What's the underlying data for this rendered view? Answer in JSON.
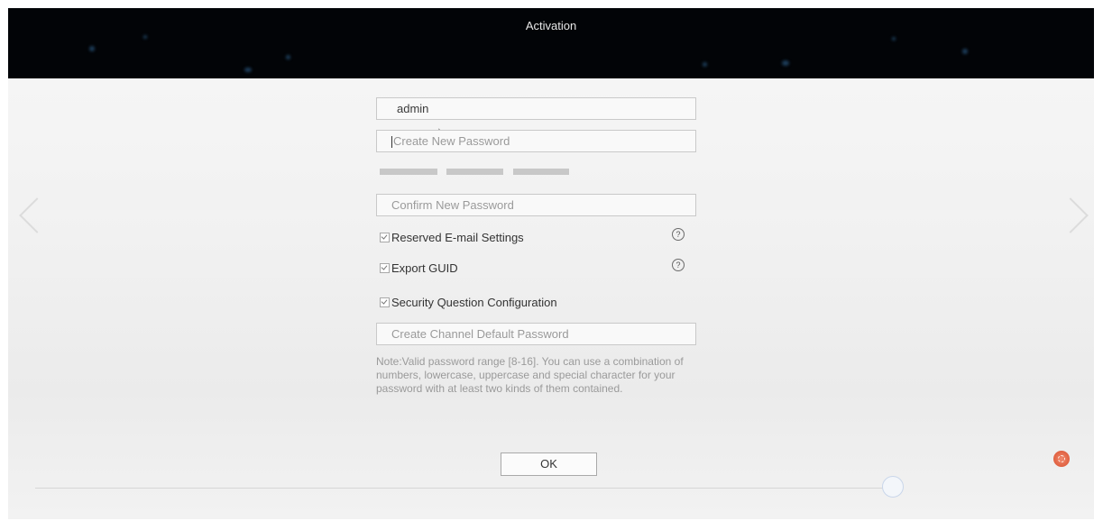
{
  "window": {
    "title": "Activation"
  },
  "form": {
    "username_value": "admin",
    "new_password_placeholder": "Create New Password",
    "confirm_password_placeholder": "Confirm New Password",
    "channel_password_placeholder": "Create Channel Default Password",
    "options": [
      {
        "label": "Reserved E-mail Settings",
        "checked": true,
        "help": true
      },
      {
        "label": "Export GUID",
        "checked": true,
        "help": true
      },
      {
        "label": "Security Question Configuration",
        "checked": true,
        "help": false
      }
    ],
    "help_symbol": "?",
    "note": "Note:Valid password range [8-16]. You can use a combination of numbers, lowercase, uppercase and special character for your password with at least two kinds of them contained.",
    "ok_label": "OK"
  },
  "icons": {
    "nav_left": "chevron-left-icon",
    "nav_right": "chevron-right-icon",
    "help": "question-circle-icon",
    "corner": "settings-badge-icon"
  },
  "colors": {
    "titlebar": "#020407",
    "accent_orange": "#e06040"
  }
}
